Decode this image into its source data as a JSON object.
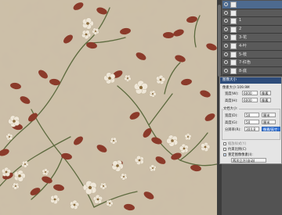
{
  "colors": {
    "canvas_bg": "#cdbfa7",
    "leaf": "#8b3a2a",
    "branch": "#5d6a3e",
    "flower": "#efe7d8",
    "panel_bg": "#535353",
    "dialog_title_bg": "#2e4c7a",
    "selection": "#4d6a8f"
  },
  "layers": [
    {
      "name": "",
      "tag": "",
      "active": true,
      "icon": "layer-thumbnail-icon"
    },
    {
      "name": "",
      "tag": "",
      "active": false,
      "icon": "layer-thumbnail-icon"
    },
    {
      "name": "1",
      "tag": "",
      "active": false,
      "icon": "layer-thumbnail-icon"
    },
    {
      "name": "2",
      "tag": "",
      "active": false,
      "icon": "layer-thumbnail-icon"
    },
    {
      "name": "3-花",
      "tag": "",
      "active": false,
      "icon": "layer-thumbnail-icon"
    },
    {
      "name": "4-叶",
      "tag": "",
      "active": false,
      "icon": "layer-thumbnail-icon"
    },
    {
      "name": "5-枝",
      "tag": "",
      "active": false,
      "icon": "layer-thumbnail-icon"
    },
    {
      "name": "7-红色",
      "tag": "",
      "active": false,
      "icon": "layer-thumbnail-icon"
    },
    {
      "name": "8-底",
      "tag": "",
      "active": false,
      "icon": "layer-thumbnail-icon"
    }
  ],
  "dialog": {
    "title": "图像大小",
    "pixel_dimensions": "像素大小:109.9M",
    "width_label": "宽度(W):",
    "width_value": "6000",
    "width_unit": "像素",
    "height_label": "高度(H):",
    "height_value": "6000",
    "height_unit": "像素",
    "doc_size": "文档大小:",
    "doc_width_label": "宽度(D):",
    "doc_width_value": "50",
    "doc_width_unit": "厘米",
    "doc_height_label": "高度(G):",
    "doc_height_value": "50",
    "doc_height_unit": "厘米",
    "resolution_label": "分辨率(R):",
    "resolution_value": "304.8",
    "resolution_unit": "像素/英寸",
    "scale_styles": "缩放样式(Y)",
    "constrain": "约束比例(C)",
    "resample": "重定图像像素(I):",
    "resample_method": "两次立方(自动)"
  }
}
